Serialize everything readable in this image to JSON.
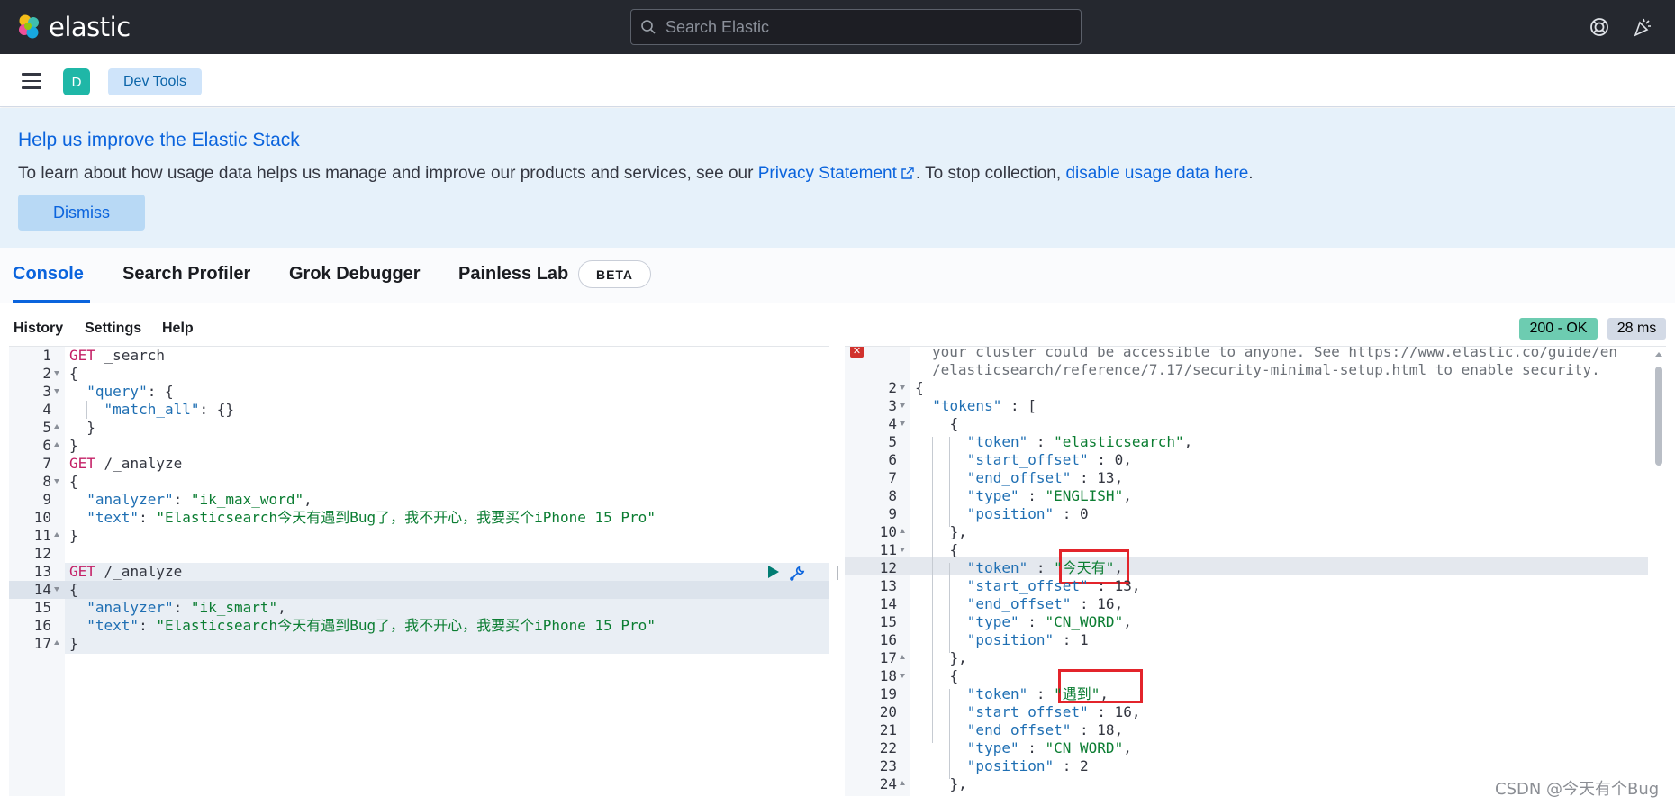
{
  "app": {
    "logo_text": "elastic"
  },
  "search": {
    "placeholder": "Search Elastic"
  },
  "header": {
    "avatar_letter": "D",
    "breadcrumb": "Dev Tools"
  },
  "callout": {
    "title": "Help us improve the Elastic Stack",
    "text_before": "To learn about how usage data helps us manage and improve our products and services, see our ",
    "privacy_link": "Privacy Statement",
    "text_middle": ". To stop collection, ",
    "disable_link": "disable usage data here",
    "text_after": ".",
    "dismiss_label": "Dismiss"
  },
  "tabs": [
    {
      "label": "Console",
      "active": true
    },
    {
      "label": "Search Profiler",
      "active": false
    },
    {
      "label": "Grok Debugger",
      "active": false
    },
    {
      "label": "Painless Lab",
      "active": false,
      "badge": "BETA"
    }
  ],
  "toolbar": {
    "history": "History",
    "settings": "Settings",
    "help": "Help"
  },
  "response": {
    "status": "200 - OK",
    "time": "28 ms"
  },
  "editor": {
    "lines": [
      {
        "n": "1",
        "fold": "",
        "tokens": [
          [
            "m",
            "GET"
          ],
          [
            "n",
            " _search"
          ]
        ]
      },
      {
        "n": "2",
        "fold": "down",
        "tokens": [
          [
            "p",
            "{"
          ]
        ]
      },
      {
        "n": "3",
        "fold": "down",
        "tokens": [
          [
            "p",
            "  "
          ],
          [
            "k",
            "\"query\""
          ],
          [
            "p",
            ": {"
          ]
        ]
      },
      {
        "n": "4",
        "fold": "",
        "tokens": [
          [
            "p",
            "    "
          ],
          [
            "k",
            "\"match_all\""
          ],
          [
            "p",
            ": {}"
          ]
        ]
      },
      {
        "n": "5",
        "fold": "up",
        "tokens": [
          [
            "p",
            "  }"
          ]
        ]
      },
      {
        "n": "6",
        "fold": "up",
        "tokens": [
          [
            "p",
            "}"
          ]
        ]
      },
      {
        "n": "7",
        "fold": "",
        "tokens": [
          [
            "m",
            "GET"
          ],
          [
            "n",
            " /_analyze"
          ]
        ]
      },
      {
        "n": "8",
        "fold": "down",
        "tokens": [
          [
            "p",
            "{"
          ]
        ]
      },
      {
        "n": "9",
        "fold": "",
        "tokens": [
          [
            "p",
            "  "
          ],
          [
            "k",
            "\"analyzer\""
          ],
          [
            "p",
            ": "
          ],
          [
            "s",
            "\"ik_max_word\""
          ],
          [
            "p",
            ","
          ]
        ]
      },
      {
        "n": "10",
        "fold": "",
        "tokens": [
          [
            "p",
            "  "
          ],
          [
            "k",
            "\"text\""
          ],
          [
            "p",
            ": "
          ],
          [
            "s",
            "\"Elasticsearch今天有遇到Bug了，我不开心，我要买个iPhone 15 Pro\""
          ]
        ]
      },
      {
        "n": "11",
        "fold": "up",
        "tokens": [
          [
            "p",
            "}"
          ]
        ]
      },
      {
        "n": "12",
        "fold": "",
        "tokens": []
      },
      {
        "n": "13",
        "fold": "",
        "tokens": [
          [
            "m",
            "GET"
          ],
          [
            "n",
            " /_analyze"
          ]
        ]
      },
      {
        "n": "14",
        "fold": "down",
        "tokens": [
          [
            "p",
            "{"
          ]
        ]
      },
      {
        "n": "15",
        "fold": "",
        "tokens": [
          [
            "p",
            "  "
          ],
          [
            "k",
            "\"analyzer\""
          ],
          [
            "p",
            ": "
          ],
          [
            "s",
            "\"ik_smart\""
          ],
          [
            "p",
            ","
          ]
        ]
      },
      {
        "n": "16",
        "fold": "",
        "tokens": [
          [
            "p",
            "  "
          ],
          [
            "k",
            "\"text\""
          ],
          [
            "p",
            ": "
          ],
          [
            "s",
            "\"Elasticsearch今天有遇到Bug了，我不开心，我要买个iPhone 15 Pro\""
          ]
        ]
      },
      {
        "n": "17",
        "fold": "up",
        "tokens": [
          [
            "p",
            "}"
          ]
        ]
      }
    ]
  },
  "output": {
    "warning_lines": [
      "your cluster could be accessible to anyone. See https://www.elastic.co/guide/en",
      "/elasticsearch/reference/7.17/security-minimal-setup.html to enable security."
    ],
    "lines": [
      {
        "n": "2",
        "fold": "down",
        "tokens": [
          [
            "p",
            "{"
          ]
        ]
      },
      {
        "n": "3",
        "fold": "down",
        "tokens": [
          [
            "p",
            "  "
          ],
          [
            "k",
            "\"tokens\""
          ],
          [
            "p",
            " : ["
          ]
        ]
      },
      {
        "n": "4",
        "fold": "down",
        "tokens": [
          [
            "p",
            "    {"
          ]
        ]
      },
      {
        "n": "5",
        "fold": "",
        "tokens": [
          [
            "p",
            "      "
          ],
          [
            "k",
            "\"token\""
          ],
          [
            "p",
            " : "
          ],
          [
            "s",
            "\"elasticsearch\""
          ],
          [
            "p",
            ","
          ]
        ]
      },
      {
        "n": "6",
        "fold": "",
        "tokens": [
          [
            "p",
            "      "
          ],
          [
            "k",
            "\"start_offset\""
          ],
          [
            "p",
            " : "
          ],
          [
            "n",
            "0"
          ],
          [
            "p",
            ","
          ]
        ]
      },
      {
        "n": "7",
        "fold": "",
        "tokens": [
          [
            "p",
            "      "
          ],
          [
            "k",
            "\"end_offset\""
          ],
          [
            "p",
            " : "
          ],
          [
            "n",
            "13"
          ],
          [
            "p",
            ","
          ]
        ]
      },
      {
        "n": "8",
        "fold": "",
        "tokens": [
          [
            "p",
            "      "
          ],
          [
            "k",
            "\"type\""
          ],
          [
            "p",
            " : "
          ],
          [
            "s",
            "\"ENGLISH\""
          ],
          [
            "p",
            ","
          ]
        ]
      },
      {
        "n": "9",
        "fold": "",
        "tokens": [
          [
            "p",
            "      "
          ],
          [
            "k",
            "\"position\""
          ],
          [
            "p",
            " : "
          ],
          [
            "n",
            "0"
          ]
        ]
      },
      {
        "n": "10",
        "fold": "up",
        "tokens": [
          [
            "p",
            "    },"
          ]
        ]
      },
      {
        "n": "11",
        "fold": "down",
        "tokens": [
          [
            "p",
            "    {"
          ]
        ]
      },
      {
        "n": "12",
        "fold": "",
        "tokens": [
          [
            "p",
            "      "
          ],
          [
            "k",
            "\"token\""
          ],
          [
            "p",
            " : "
          ],
          [
            "s",
            "\"今天有\""
          ],
          [
            "p",
            ","
          ]
        ]
      },
      {
        "n": "13",
        "fold": "",
        "tokens": [
          [
            "p",
            "      "
          ],
          [
            "k",
            "\"start_offset\""
          ],
          [
            "p",
            " : "
          ],
          [
            "n",
            "13"
          ],
          [
            "p",
            ","
          ]
        ]
      },
      {
        "n": "14",
        "fold": "",
        "tokens": [
          [
            "p",
            "      "
          ],
          [
            "k",
            "\"end_offset\""
          ],
          [
            "p",
            " : "
          ],
          [
            "n",
            "16"
          ],
          [
            "p",
            ","
          ]
        ]
      },
      {
        "n": "15",
        "fold": "",
        "tokens": [
          [
            "p",
            "      "
          ],
          [
            "k",
            "\"type\""
          ],
          [
            "p",
            " : "
          ],
          [
            "s",
            "\"CN_WORD\""
          ],
          [
            "p",
            ","
          ]
        ]
      },
      {
        "n": "16",
        "fold": "",
        "tokens": [
          [
            "p",
            "      "
          ],
          [
            "k",
            "\"position\""
          ],
          [
            "p",
            " : "
          ],
          [
            "n",
            "1"
          ]
        ]
      },
      {
        "n": "17",
        "fold": "up",
        "tokens": [
          [
            "p",
            "    },"
          ]
        ]
      },
      {
        "n": "18",
        "fold": "down",
        "tokens": [
          [
            "p",
            "    {"
          ]
        ]
      },
      {
        "n": "19",
        "fold": "",
        "tokens": [
          [
            "p",
            "      "
          ],
          [
            "k",
            "\"token\""
          ],
          [
            "p",
            " : "
          ],
          [
            "s",
            "\"遇到\""
          ],
          [
            "p",
            ","
          ]
        ]
      },
      {
        "n": "20",
        "fold": "",
        "tokens": [
          [
            "p",
            "      "
          ],
          [
            "k",
            "\"start_offset\""
          ],
          [
            "p",
            " : "
          ],
          [
            "n",
            "16"
          ],
          [
            "p",
            ","
          ]
        ]
      },
      {
        "n": "21",
        "fold": "",
        "tokens": [
          [
            "p",
            "      "
          ],
          [
            "k",
            "\"end_offset\""
          ],
          [
            "p",
            " : "
          ],
          [
            "n",
            "18"
          ],
          [
            "p",
            ","
          ]
        ]
      },
      {
        "n": "22",
        "fold": "",
        "tokens": [
          [
            "p",
            "      "
          ],
          [
            "k",
            "\"type\""
          ],
          [
            "p",
            " : "
          ],
          [
            "s",
            "\"CN_WORD\""
          ],
          [
            "p",
            ","
          ]
        ]
      },
      {
        "n": "23",
        "fold": "",
        "tokens": [
          [
            "p",
            "      "
          ],
          [
            "k",
            "\"position\""
          ],
          [
            "p",
            " : "
          ],
          [
            "n",
            "2"
          ]
        ]
      },
      {
        "n": "24",
        "fold": "up",
        "tokens": [
          [
            "p",
            "    },"
          ]
        ]
      }
    ]
  },
  "watermark": "CSDN @今天有个Bug",
  "colors": {
    "accent": "#0b64dd",
    "status_ok": "#6dccb1",
    "method": "#c42167",
    "string": "#0b7d32",
    "key": "#1f6fb3"
  }
}
